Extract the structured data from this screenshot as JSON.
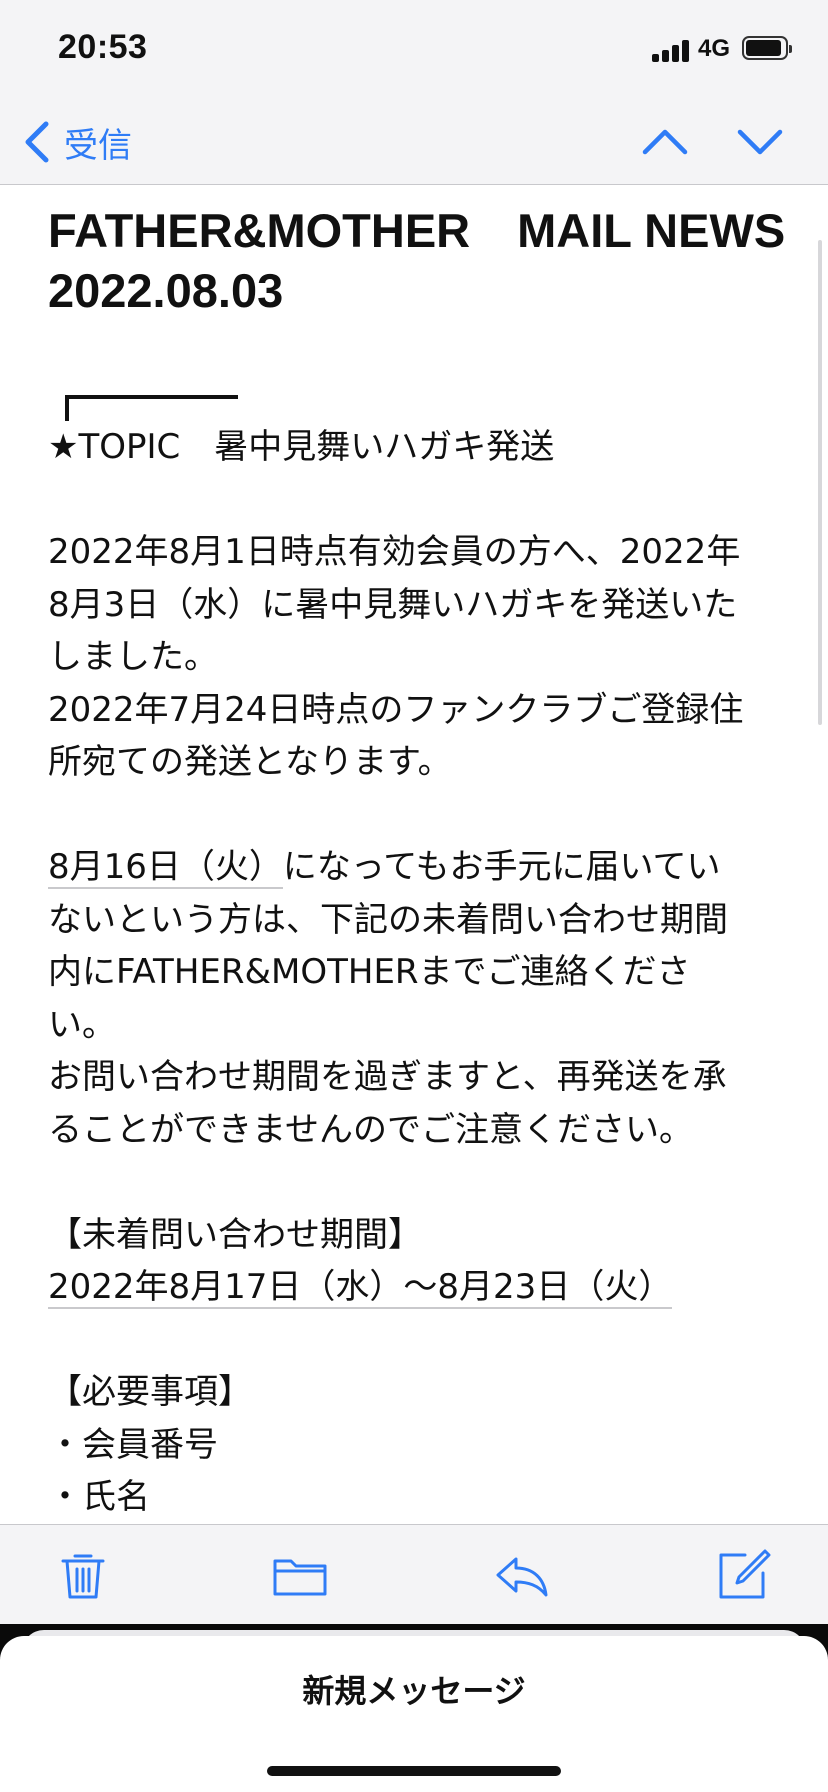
{
  "status_bar": {
    "time": "20:53",
    "network": "4G"
  },
  "nav": {
    "back_label": "受信"
  },
  "email": {
    "subject_line1": "FATHER&MOTHER　MAIL NEWS",
    "subject_line2": "2022.08.03",
    "body_lines": [
      "★TOPIC　暑中見舞いハガキ発送",
      "",
      "2022年8月1日時点有効会員の方へ、2022年",
      "8月3日（水）に暑中見舞いハガキを発送いた",
      "しました。",
      "2022年7月24日時点のファンクラブご登録住",
      "所宛ての発送となります。",
      "",
      "8月16日（火）になってもお手元に届いてい",
      "ないという方は、下記の未着問い合わせ期間",
      "内にFATHER&MOTHERまでご連絡くださ",
      "い。",
      "お問い合わせ期間を過ぎますと、再発送を承",
      "ることができませんのでご注意ください。",
      "",
      "【未着問い合わせ期間】",
      "2022年8月17日（水）～8月23日（火）",
      "",
      "【必要事項】",
      "・会員番号",
      "・氏名"
    ],
    "date_link_1": "8月16日（火）",
    "line_after_link": "になってもお手元に届いてい"
  },
  "toolbar": {
    "icons": [
      "trash-icon",
      "folder-icon",
      "reply-icon",
      "compose-icon"
    ]
  },
  "compose_sheet": {
    "title": "新規メッセージ"
  },
  "colors": {
    "accent": "#2f7cf6",
    "bar_background": "#f4f4f6"
  }
}
